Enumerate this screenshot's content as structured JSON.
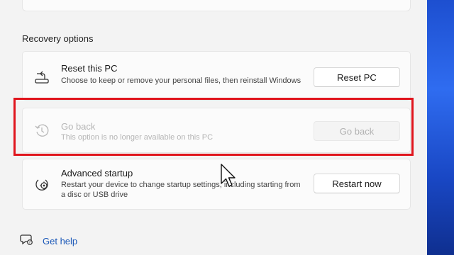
{
  "section": {
    "title": "Recovery options"
  },
  "reset": {
    "title": "Reset this PC",
    "description": "Choose to keep or remove your personal files, then reinstall Windows",
    "button": "Reset PC",
    "icon": "reset-pc-icon"
  },
  "go_back": {
    "title": "Go back",
    "description": "This option is no longer available on this PC",
    "button": "Go back",
    "icon": "history-clock-icon",
    "state": "disabled"
  },
  "advanced": {
    "title": "Advanced startup",
    "description": "Restart your device to change startup settings, including starting from a disc or USB drive",
    "button": "Restart now",
    "icon": "advanced-startup-gear-icon"
  },
  "help": {
    "label": "Get help",
    "icon": "help-chat-icon"
  },
  "colors": {
    "highlight": "#e0151d",
    "link": "#1b58b8",
    "accent_strip": "#1d4fd0"
  }
}
